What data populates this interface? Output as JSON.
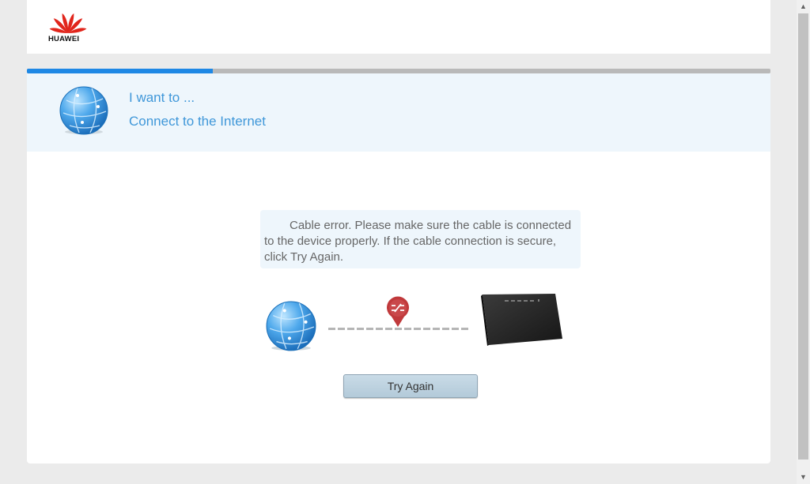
{
  "brand": {
    "name": "HUAWEI",
    "color": "#e1251b"
  },
  "wizard": {
    "progress_percent": 25
  },
  "banner": {
    "icon": "globe-icon",
    "intro": "I want to ...",
    "goal": "Connect to the Internet"
  },
  "status": {
    "message": "Cable error. Please make sure the cable is connected to the device properly. If the cable connection is secure, click Try Again.",
    "diagram": {
      "left_icon": "globe-icon",
      "error_icon": "disconnected-pin-icon",
      "right_icon": "router-icon"
    }
  },
  "actions": {
    "try_again_label": "Try Again"
  },
  "colors": {
    "accent": "#3f97d9",
    "progress": "#1e88e5",
    "banner_bg": "#eef6fc",
    "error_pin": "#c0393b"
  }
}
